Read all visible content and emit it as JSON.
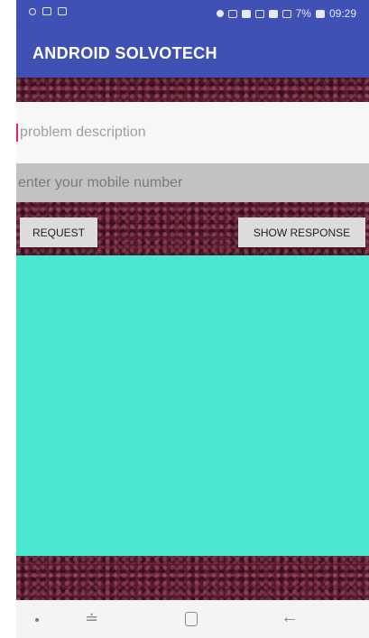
{
  "status_bar": {
    "battery": "7%",
    "time": "09:29"
  },
  "app_bar": {
    "title": "ANDROID SOLVOTECH"
  },
  "form": {
    "problem_placeholder": "problem description",
    "mobile_placeholder": "enter your mobile number"
  },
  "buttons": {
    "request": "REQUEST",
    "show_response": "SHOW RESPONSE"
  },
  "nav_bar": {
    "recent_icon": "≐",
    "back_icon": "←"
  },
  "colors": {
    "primary": "#3f51b5",
    "response_panel": "#4ae8d0",
    "background": "#5a1a2c",
    "cursor": "#e91e63"
  }
}
